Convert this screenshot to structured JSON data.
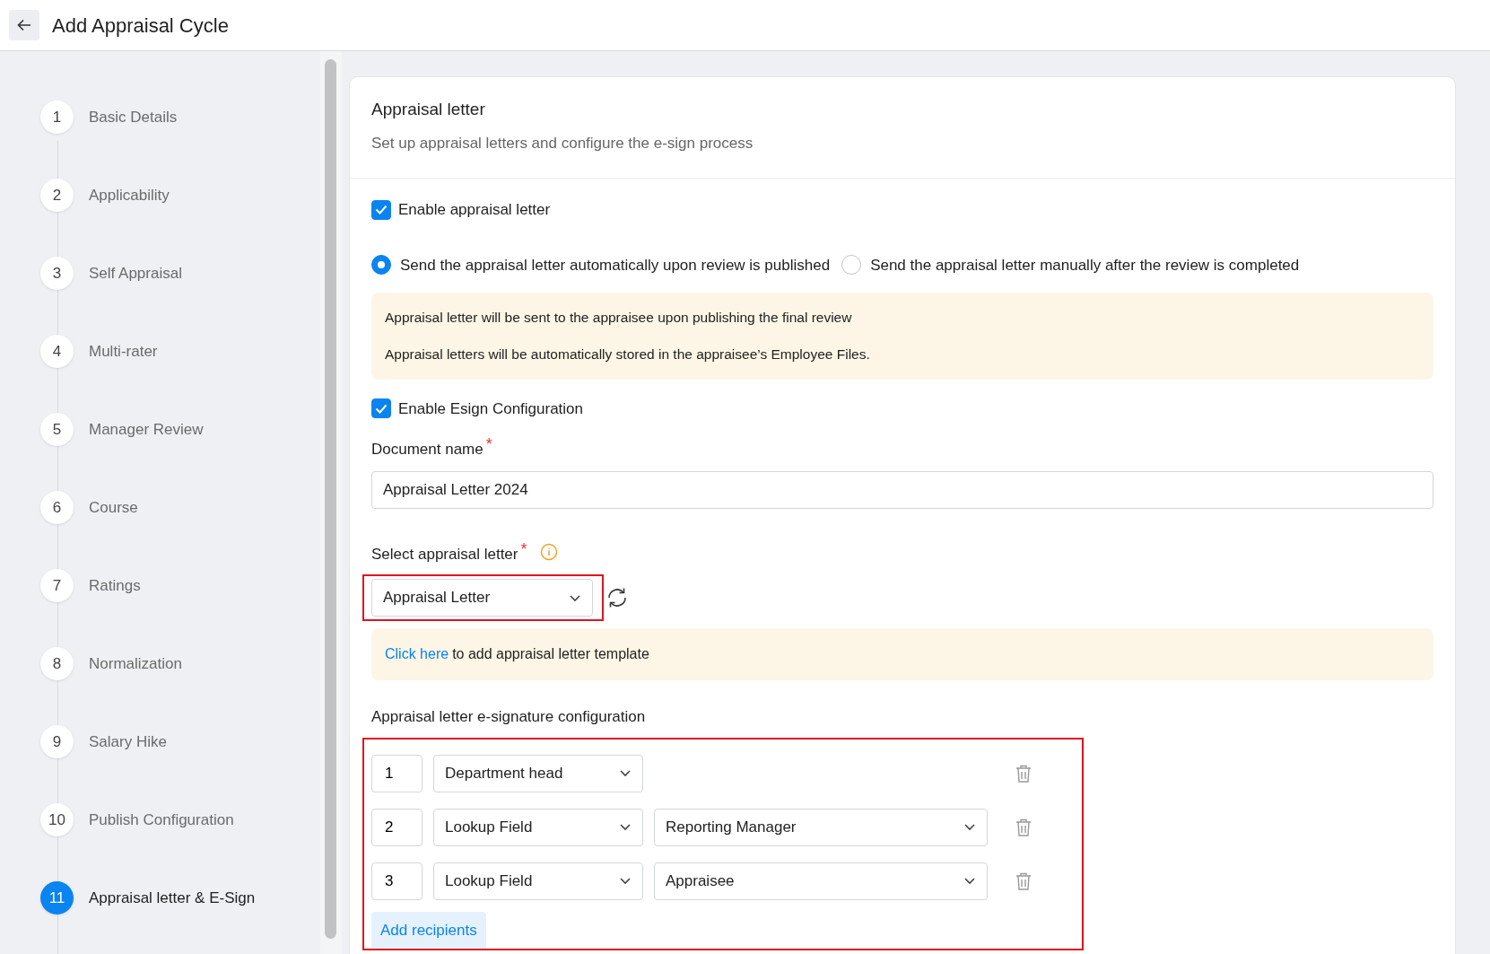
{
  "header": {
    "title": "Add Appraisal Cycle"
  },
  "steps": [
    {
      "number": "1",
      "label": "Basic Details",
      "selected": false
    },
    {
      "number": "2",
      "label": "Applicability",
      "selected": false
    },
    {
      "number": "3",
      "label": "Self Appraisal",
      "selected": false
    },
    {
      "number": "4",
      "label": "Multi-rater",
      "selected": false
    },
    {
      "number": "5",
      "label": "Manager Review",
      "selected": false
    },
    {
      "number": "6",
      "label": "Course",
      "selected": false
    },
    {
      "number": "7",
      "label": "Ratings",
      "selected": false
    },
    {
      "number": "8",
      "label": "Normalization",
      "selected": false
    },
    {
      "number": "9",
      "label": "Salary Hike",
      "selected": false
    },
    {
      "number": "10",
      "label": "Publish Configuration",
      "selected": false
    },
    {
      "number": "11",
      "label": "Appraisal letter & E-Sign",
      "selected": true
    }
  ],
  "section": {
    "title": "Appraisal letter",
    "subtitle": "Set up appraisal letters and configure the e-sign process"
  },
  "enable_letter": {
    "label": "Enable appraisal letter",
    "checked": true
  },
  "send_options": [
    {
      "label": "Send the appraisal letter automatically upon review is published",
      "selected": true
    },
    {
      "label": "Send the appraisal letter manually after the review is completed",
      "selected": false
    }
  ],
  "notes": [
    "Appraisal letter will be sent to the appraisee upon publishing the final review",
    "Appraisal letters will be automatically stored in the appraisee’s Employee Files."
  ],
  "enable_esign": {
    "label": "Enable Esign Configuration",
    "checked": true
  },
  "document_name": {
    "label": "Document name",
    "required_mark": "*",
    "value": "Appraisal Letter 2024"
  },
  "select_letter": {
    "label": "Select appraisal letter",
    "required_mark": "*",
    "value": "Appraisal Letter",
    "highlighted": true
  },
  "template_hint": {
    "link": "Click here",
    "text": "to add appraisal letter template"
  },
  "signature": {
    "title": "Appraisal letter e-signature configuration",
    "highlighted": true,
    "recipients": [
      {
        "order": "1",
        "type": "Department head"
      },
      {
        "order": "2",
        "type": "Lookup Field",
        "field": "Reporting Manager"
      },
      {
        "order": "3",
        "type": "Lookup Field",
        "field": "Appraisee"
      }
    ],
    "add_button": "Add recipients"
  }
}
